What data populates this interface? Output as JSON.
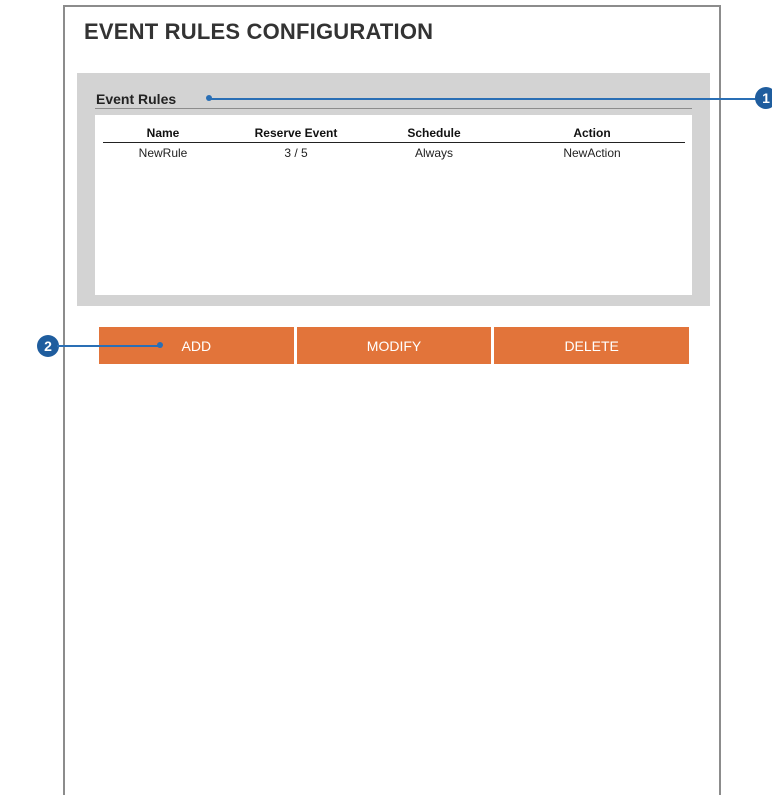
{
  "page": {
    "title": "EVENT RULES CONFIGURATION"
  },
  "panel": {
    "title": "Event Rules",
    "columns": [
      "Name",
      "Reserve Event",
      "Schedule",
      "Action"
    ],
    "rows": [
      [
        "NewRule",
        "3 / 5",
        "Always",
        "NewAction"
      ]
    ]
  },
  "buttons": {
    "add": "ADD",
    "modify": "MODIFY",
    "delete": "DELETE"
  },
  "callouts": {
    "first": "1",
    "second": "2"
  },
  "colors": {
    "button": "#e2743a",
    "panel": "#d3d3d3",
    "callout": "#1f5d9e"
  }
}
